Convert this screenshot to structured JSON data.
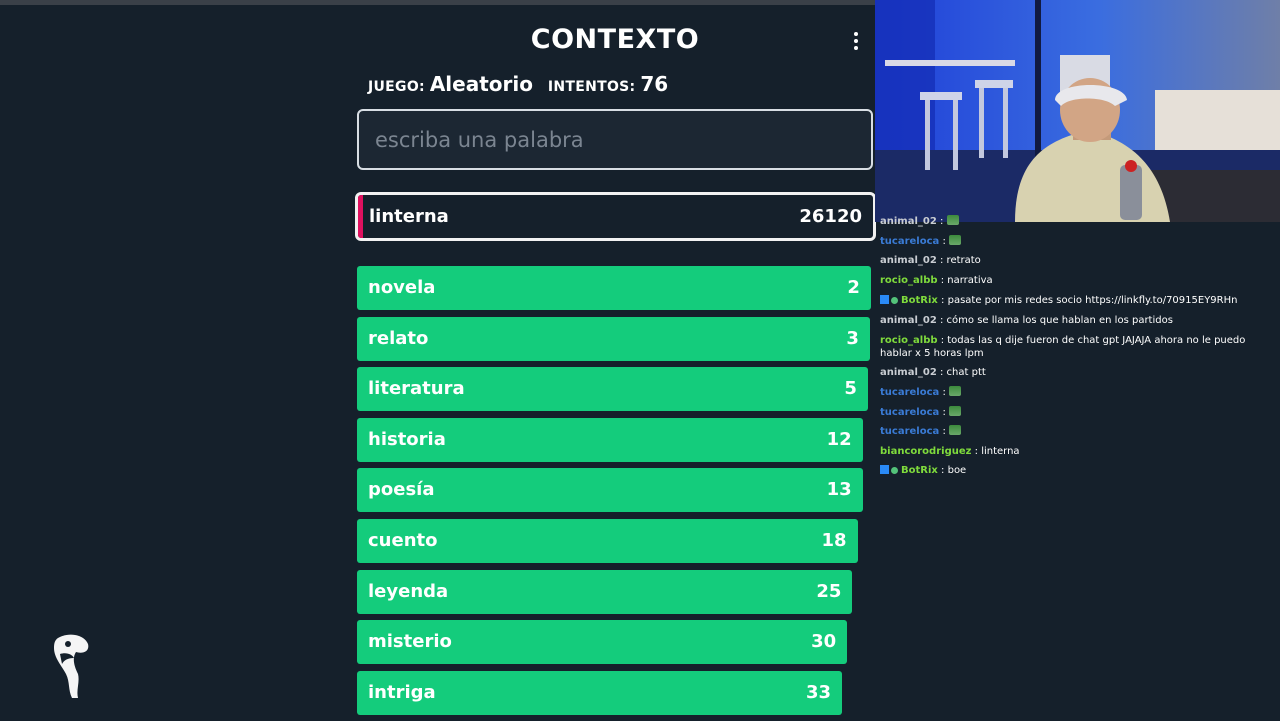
{
  "game": {
    "title": "CONTEXTO",
    "mode_label": "JUEGO:",
    "mode_value": "Aleatorio",
    "attempts_label": "INTENTOS:",
    "attempts_value": "76",
    "input_placeholder": "escriba una palabra",
    "input_value": "",
    "current_guess": {
      "word": "linterna",
      "rank": "26120",
      "color": "#e0115f"
    },
    "guesses": [
      {
        "word": "novela",
        "rank": "2",
        "fill": 0.996
      },
      {
        "word": "relato",
        "rank": "3",
        "fill": 0.994
      },
      {
        "word": "literatura",
        "rank": "5",
        "fill": 0.99
      },
      {
        "word": "historia",
        "rank": "12",
        "fill": 0.98
      },
      {
        "word": "poesía",
        "rank": "13",
        "fill": 0.98
      },
      {
        "word": "cuento",
        "rank": "18",
        "fill": 0.97
      },
      {
        "word": "leyenda",
        "rank": "25",
        "fill": 0.96
      },
      {
        "word": "misterio",
        "rank": "30",
        "fill": 0.95
      },
      {
        "word": "intriga",
        "rank": "33",
        "fill": 0.94
      }
    ],
    "colors": {
      "close": "#14cc7c",
      "background": "#15202b"
    }
  },
  "chat": {
    "messages": [
      {
        "user": "animal_02",
        "color": "#c9cdd2",
        "text": "",
        "emote": true
      },
      {
        "user": "tucareloca",
        "color": "#3a7bd5",
        "text": "",
        "emote": true
      },
      {
        "user": "animal_02",
        "color": "#c9cdd2",
        "text": "retrato"
      },
      {
        "user": "rocio_albb",
        "color": "#7fdb3c",
        "text": "narrativa"
      },
      {
        "user": "BotRix",
        "color": "#7fdb3c",
        "text": "pasate por mis redes socio https://linkfly.to/70915EY9RHn",
        "badges": true
      },
      {
        "user": "animal_02",
        "color": "#c9cdd2",
        "text": "cómo se llama los que hablan en los partidos"
      },
      {
        "user": "rocio_albb",
        "color": "#7fdb3c",
        "text": "todas las q dije fueron de chat gpt JAJAJA ahora no le puedo hablar x 5 horas lpm"
      },
      {
        "user": "animal_02",
        "color": "#c9cdd2",
        "text": "chat ptt"
      },
      {
        "user": "tucareloca",
        "color": "#3a7bd5",
        "text": "",
        "emote": true
      },
      {
        "user": "tucareloca",
        "color": "#3a7bd5",
        "text": "",
        "emote": true
      },
      {
        "user": "tucareloca",
        "color": "#3a7bd5",
        "text": "",
        "emote": true
      },
      {
        "user": "biancorodriguez",
        "color": "#7fdb3c",
        "text": "linterna"
      },
      {
        "user": "BotRix",
        "color": "#7fdb3c",
        "text": "boe",
        "badges": true
      }
    ],
    "separator": ":"
  },
  "icons": {
    "menu": "kebab-menu-icon",
    "logo": "toucan-logo-icon"
  }
}
